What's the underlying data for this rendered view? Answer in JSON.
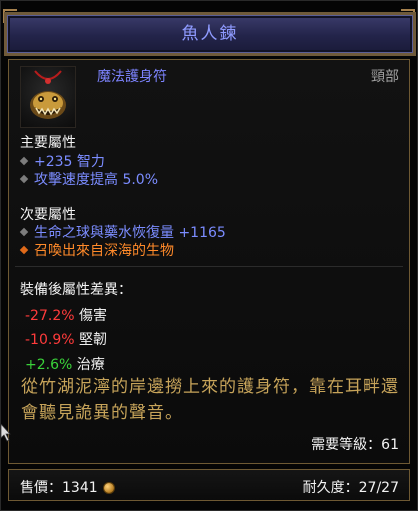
{
  "header": {
    "title": "魚人鍊"
  },
  "item": {
    "name": "魔法護身符",
    "slot": "頸部",
    "icon": "fishman-amulet-icon"
  },
  "primary": {
    "title": "主要屬性",
    "stats": [
      "+235 智力",
      "攻擊速度提高 5.0%"
    ]
  },
  "secondary": {
    "title": "次要屬性",
    "stats": [
      "生命之球與藥水恢復量 +1165",
      "召喚出來自深海的生物"
    ]
  },
  "differences": {
    "title": "裝備後屬性差異：",
    "rows": [
      {
        "value": "-27.2%",
        "label": "傷害",
        "color": "#ff3b3b"
      },
      {
        "value": "-10.9%",
        "label": "堅韌",
        "color": "#ff3b3b"
      },
      {
        "value": "+2.6%",
        "label": "治療",
        "color": "#3ad13a"
      }
    ]
  },
  "flavor": "從竹湖泥濘的岸邊撈上來的護身符，靠在耳畔還會聽見詭異的聲音。",
  "requirement": "需要等級：61",
  "footer": {
    "price_label": "售價：",
    "price_value": "1341",
    "durability_label": "耐久度：",
    "durability_value": "27/27"
  },
  "colors": {
    "magic_blue": "#7d84ff",
    "legendary_orange": "#ff8a2a",
    "flavor_gold": "#c7a45a",
    "border_bronze": "#6e5933"
  }
}
